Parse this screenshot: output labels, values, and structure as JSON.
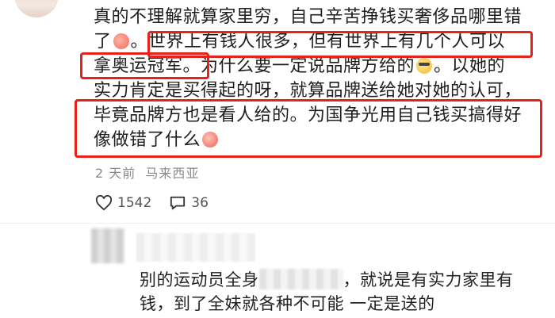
{
  "comment": {
    "line1": "真的不理解就算家里穷，自己辛苦挣钱买奢侈品哪里错",
    "line2a": "了",
    "line2b": "。世界上有钱人很多，但有世界上有几个人可以",
    "line3a": "拿奥运冠军。",
    "line3b": "为什么要一定说品牌方给的",
    "line3c": "。以她的",
    "line4": "实力肯定是买得起的呀，就算品牌送给她对她的认可，",
    "line5": "毕竟品牌方也是看人给的。为国争光用自己钱买搞得好",
    "line6": "像做错了什么",
    "emojis": [
      "peach-face-icon",
      "cool-sunglasses-icon",
      "crying-face-icon"
    ]
  },
  "meta": {
    "time": "2 天前",
    "location": "马来西亚"
  },
  "actions": {
    "likes": "1542",
    "comments": "36"
  },
  "reply": {
    "text_part1": "别的运动员全身",
    "text_part2": "，就说是有实力家里有",
    "text_line2": "钱，到了全妹就各种不可能 一定是送的"
  },
  "colors": {
    "highlight_box": "#e5221b",
    "meta_text": "#8a8a8a"
  }
}
